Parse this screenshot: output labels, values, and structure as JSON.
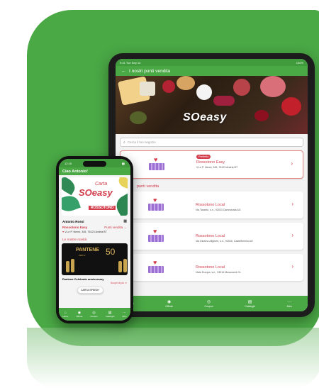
{
  "colors": {
    "brand_green": "#4aa845",
    "brand_red": "#d23c4b"
  },
  "tablet": {
    "status_left": "9:41  Tue Sep 10",
    "status_right": "100%",
    "header_title": "I nostri punti vendita",
    "hero_logo": "SOeasy",
    "search_placeholder": "Cerca il tuo negozio",
    "preferred_badge": "Preferito",
    "section_title": "punti vendita",
    "stores": [
      {
        "name": "Rossotono Easy",
        "address": "V.Le P. Nenni, 345, 76123 Andria BT"
      },
      {
        "name": "Rossotono Local",
        "address": "Via Taranto, s.n., 92023 Cammarata AG"
      },
      {
        "name": "Rossotono Local",
        "address": "Via Dinamo Alighieri, s.n., 92020, Castelfermini AG"
      },
      {
        "name": "Rossotono Local",
        "address": "Viale Europa, s.n., 93014 Mussomeli CL"
      }
    ],
    "tabs": [
      {
        "icon": "home-icon",
        "label": ""
      },
      {
        "icon": "offers-icon",
        "label": "Offerte"
      },
      {
        "icon": "coupon-icon",
        "label": "Coupon"
      },
      {
        "icon": "catalog-icon",
        "label": "Cataloghi"
      },
      {
        "icon": "more-icon",
        "label": "Altro"
      }
    ]
  },
  "phone": {
    "status_time": "12:15",
    "greeting": "Ciao Antonio!",
    "card_carta": "Carta",
    "card_logo": "SOeasy",
    "card_brand": "ROSSOTONO",
    "user_name": "Antonio Rossi",
    "store_name": "Rossotono Easy",
    "store_link": "Punti vendita →",
    "store_address": "V.Le P. Nenni, 345, 76123 Andria BT",
    "news_title": "Le nostre novità",
    "promo_brand": "PANTENE",
    "promo_sub": "PRO-V",
    "promo_fifty": "50",
    "card_button": "CARTA SPEEDY",
    "promo_title": "Pantene Celebrate anniversary",
    "scopri": "Scopri di più ➜",
    "tabs": [
      {
        "icon": "home-icon",
        "label": "Home"
      },
      {
        "icon": "offers-icon",
        "label": "Offerte"
      },
      {
        "icon": "coupon-icon",
        "label": "Coupon"
      },
      {
        "icon": "catalog-icon",
        "label": "Cataloghi"
      },
      {
        "icon": "more-icon",
        "label": "Altro"
      }
    ]
  }
}
